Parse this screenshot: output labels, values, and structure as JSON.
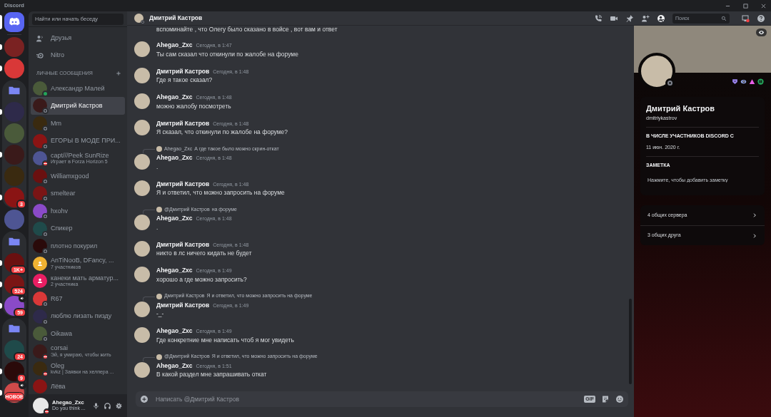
{
  "window": {
    "title": "Discord"
  },
  "servers": [
    {
      "kind": "home",
      "selected": true,
      "unread": false
    },
    {
      "kind": "server",
      "selected": false,
      "unread": true
    },
    {
      "kind": "server",
      "selected": false,
      "unread": true
    },
    {
      "kind": "folder",
      "children": [
        {
          "kind": "server",
          "selected": false,
          "unread": true
        },
        {
          "kind": "server",
          "selected": false,
          "unread": false
        },
        {
          "kind": "server",
          "selected": false,
          "unread": true
        },
        {
          "kind": "server",
          "selected": false,
          "unread": false
        },
        {
          "kind": "server",
          "selected": false,
          "unread": true,
          "badge": "3"
        }
      ]
    },
    {
      "kind": "server",
      "selected": false,
      "unread": false
    },
    {
      "kind": "folder",
      "children": [
        {
          "kind": "server",
          "selected": false,
          "unread": true,
          "badge": "1K+"
        },
        {
          "kind": "server",
          "selected": false,
          "unread": true,
          "badge": "524"
        },
        {
          "kind": "server",
          "selected": false,
          "unread": true,
          "badge": "59",
          "voice": true
        }
      ]
    },
    {
      "kind": "folder",
      "children": [
        {
          "kind": "server",
          "selected": false,
          "unread": false,
          "badge": "24"
        },
        {
          "kind": "server",
          "selected": false,
          "unread": true,
          "badge": "9"
        },
        {
          "kind": "server",
          "selected": false,
          "unread": true,
          "voice": true,
          "new_label": "НОВОЕ"
        }
      ]
    }
  ],
  "sidebar": {
    "search_placeholder": "Найти или начать беседу",
    "nav": [
      {
        "kind": "friends",
        "label": "Друзья"
      },
      {
        "kind": "nitro",
        "label": "Nitro"
      }
    ],
    "section_title": "ЛИЧНЫЕ СООБЩЕНИЯ",
    "dms": [
      {
        "kind": "user",
        "name": "Александр Малей",
        "online": true,
        "dnd": false,
        "selected": false
      },
      {
        "kind": "user",
        "name": "Дмитрий Кастров",
        "online": false,
        "dnd": false,
        "selected": true
      },
      {
        "kind": "user",
        "name": "Mm",
        "online": false,
        "dnd": false,
        "selected": false
      },
      {
        "kind": "user",
        "name": "ЕГОРЫ В МОДЕ ПРИ...",
        "online": false,
        "dnd": false,
        "selected": false
      },
      {
        "kind": "user",
        "name": "capt///Peek SunRize",
        "subtitle": "Играет в Forza Horizon 5",
        "online": false,
        "dnd": true,
        "selected": false
      },
      {
        "kind": "user",
        "name": "Williamxgood",
        "online": false,
        "dnd": false,
        "selected": false
      },
      {
        "kind": "user",
        "name": "smeltear",
        "online": false,
        "dnd": false,
        "selected": false
      },
      {
        "kind": "user",
        "name": "hxohv",
        "online": false,
        "dnd": false,
        "selected": false
      },
      {
        "kind": "user",
        "name": "Спикер",
        "online": false,
        "dnd": false,
        "selected": false
      },
      {
        "kind": "user",
        "name": "плотно покурил",
        "online": false,
        "dnd": false,
        "selected": false
      },
      {
        "kind": "group",
        "name": "AnTiNooB, DFancy, ...",
        "subtitle": "7 участников",
        "color": "#f0b232",
        "selected": false
      },
      {
        "kind": "group",
        "name": "канеки мать арматур...",
        "subtitle": "2 участника",
        "color": "#e91e63",
        "selected": false
      },
      {
        "kind": "user",
        "name": "R67",
        "online": false,
        "dnd": false,
        "selected": false
      },
      {
        "kind": "user",
        "name": "люблю лизать пизду",
        "online": false,
        "dnd": false,
        "selected": false
      },
      {
        "kind": "user",
        "name": "Oikawa",
        "online": false,
        "dnd": false,
        "selected": false
      },
      {
        "kind": "user",
        "name": "corsai",
        "subtitle": "Эй, я умираю, чтобы жить",
        "online": false,
        "dnd": true,
        "selected": false
      },
      {
        "kind": "user",
        "name": "Oleg",
        "subtitle": "kvkz | Заявки на хелпера ...",
        "online": false,
        "dnd": true,
        "selected": false
      },
      {
        "kind": "user",
        "name": "Лёва",
        "selected": false
      }
    ]
  },
  "user_panel": {
    "name": "Ahegao_Zxc",
    "status_text": "Do you think ...",
    "dnd": true
  },
  "header": {
    "name": "Дмитрий Кастров",
    "online": false,
    "dnd": false,
    "search_placeholder": "Поиск",
    "profile_panel_on": true,
    "inbox_unread": true
  },
  "messages": [
    {
      "kind": "continuation",
      "text": "вспоминайте , что Олегу было сказано в войсе , вот вам и ответ"
    },
    {
      "kind": "message",
      "author": "Ahegao_Zxc",
      "time": "Сегодня, в 1:47",
      "text": "Ты сам сказал что откинули по жалобе на форуме"
    },
    {
      "kind": "message",
      "author": "Дмитрий Кастров",
      "time": "Сегодня, в 1:48",
      "text": "Где я такое сказал?"
    },
    {
      "kind": "message",
      "author": "Ahegao_Zxc",
      "time": "Сегодня, в 1:48",
      "text": "можно жалобу посмотреть"
    },
    {
      "kind": "message",
      "author": "Дмитрий Кастров",
      "time": "Сегодня, в 1:48",
      "text": "Я сказал, что откинули по жалобе на форуме?"
    },
    {
      "kind": "message",
      "reply": {
        "author": "Ahegao_Zxc",
        "text": "А где такое было можно скрин-откат"
      },
      "author": "Ahegao_Zxc",
      "time": "Сегодня, в 1:48",
      "text": "."
    },
    {
      "kind": "message",
      "author": "Дмитрий Кастров",
      "time": "Сегодня, в 1:48",
      "text": "Я и ответил, что можно запросить на форуме"
    },
    {
      "kind": "message",
      "reply": {
        "author": "@Дмитрий Кастров",
        "text": "на форуме"
      },
      "author": "Ahegao_Zxc",
      "time": "Сегодня, в 1:48",
      "text": "."
    },
    {
      "kind": "message",
      "author": "Дмитрий Кастров",
      "time": "Сегодня, в 1:48",
      "text": "никто в лс ничего кидать не будет"
    },
    {
      "kind": "message",
      "author": "Ahegao_Zxc",
      "time": "Сегодня, в 1:49",
      "text": "хорошо а где можно запросить?"
    },
    {
      "kind": "message",
      "reply": {
        "author": "Дмитрий Кастров",
        "text": "Я и ответил, что можно запросить на форуме"
      },
      "author": "Дмитрий Кастров",
      "time": "Сегодня, в 1:49",
      "text": "-_-"
    },
    {
      "kind": "message",
      "author": "Ahegao_Zxc",
      "time": "Сегодня, в 1:49",
      "text": "Где конкретние мне написать чтоб я мог увидеть"
    },
    {
      "kind": "message",
      "reply": {
        "author": "@Дмитрий Кастров",
        "text": "Я и ответил, что можно запросить на форуме"
      },
      "author": "Ahegao_Zxc",
      "time": "Сегодня, в 1:51",
      "text": "В какой раздел мне запрашивать откат"
    }
  ],
  "composer": {
    "placeholder": "Написать @Дмитрий Кастров",
    "gif_label": "GIF"
  },
  "profile": {
    "online": false,
    "dnd": false,
    "name": "Дмитрий Кастров",
    "username": "dmitriykastrov",
    "member_since_title": "В ЧИСЛЕ УЧАСТНИКОВ DISCORD С",
    "member_since": "11 июн. 2020 г.",
    "note_title": "ЗАМЕТКА",
    "note_placeholder": "Нажмите, чтобы добавить заметку",
    "mutual": [
      {
        "label": "4 общих сервера"
      },
      {
        "label": "3 общих друга"
      }
    ]
  }
}
